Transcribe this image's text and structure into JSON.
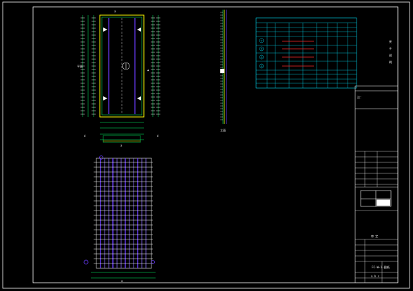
{
  "drawing": {
    "plan_label": "平面",
    "section_label": "立面",
    "table": {
      "title_rows": [
        "",
        "",
        ""
      ],
      "rows": [
        "①",
        "②",
        "③",
        "④"
      ]
    },
    "right_note": "关于说明",
    "side_note": "注：",
    "title_block": {
      "approval": "审 定",
      "project": "",
      "drawing_name": "",
      "drawing_no": "",
      "sheet": ""
    }
  },
  "colors": {
    "background": "#000000",
    "frame": "#ffffff",
    "outline": "#00ff66",
    "accent": "#ffff00",
    "rebar_fill": "#6a3cff",
    "table": "#00e5ff",
    "mark": "#ff2a2a"
  }
}
